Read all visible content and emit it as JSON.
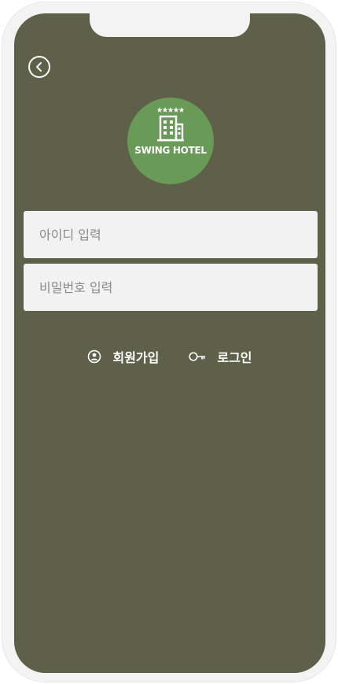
{
  "app": {
    "logo_text": "SWING HOTEL"
  },
  "login_form": {
    "id_placeholder": "아이디 입력",
    "password_placeholder": "비밀번호 입력"
  },
  "actions": {
    "signup_label": "회원가입",
    "login_label": "로그인"
  },
  "icons": {
    "back": "back-chevron-icon",
    "logo": "hotel-building-icon",
    "signup": "user-circle-icon",
    "login": "key-icon"
  },
  "colors": {
    "screen_background": "#5e6049",
    "logo_badge": "#6a9a58",
    "input_background": "#f2f2f2",
    "text_light": "#ffffff"
  }
}
